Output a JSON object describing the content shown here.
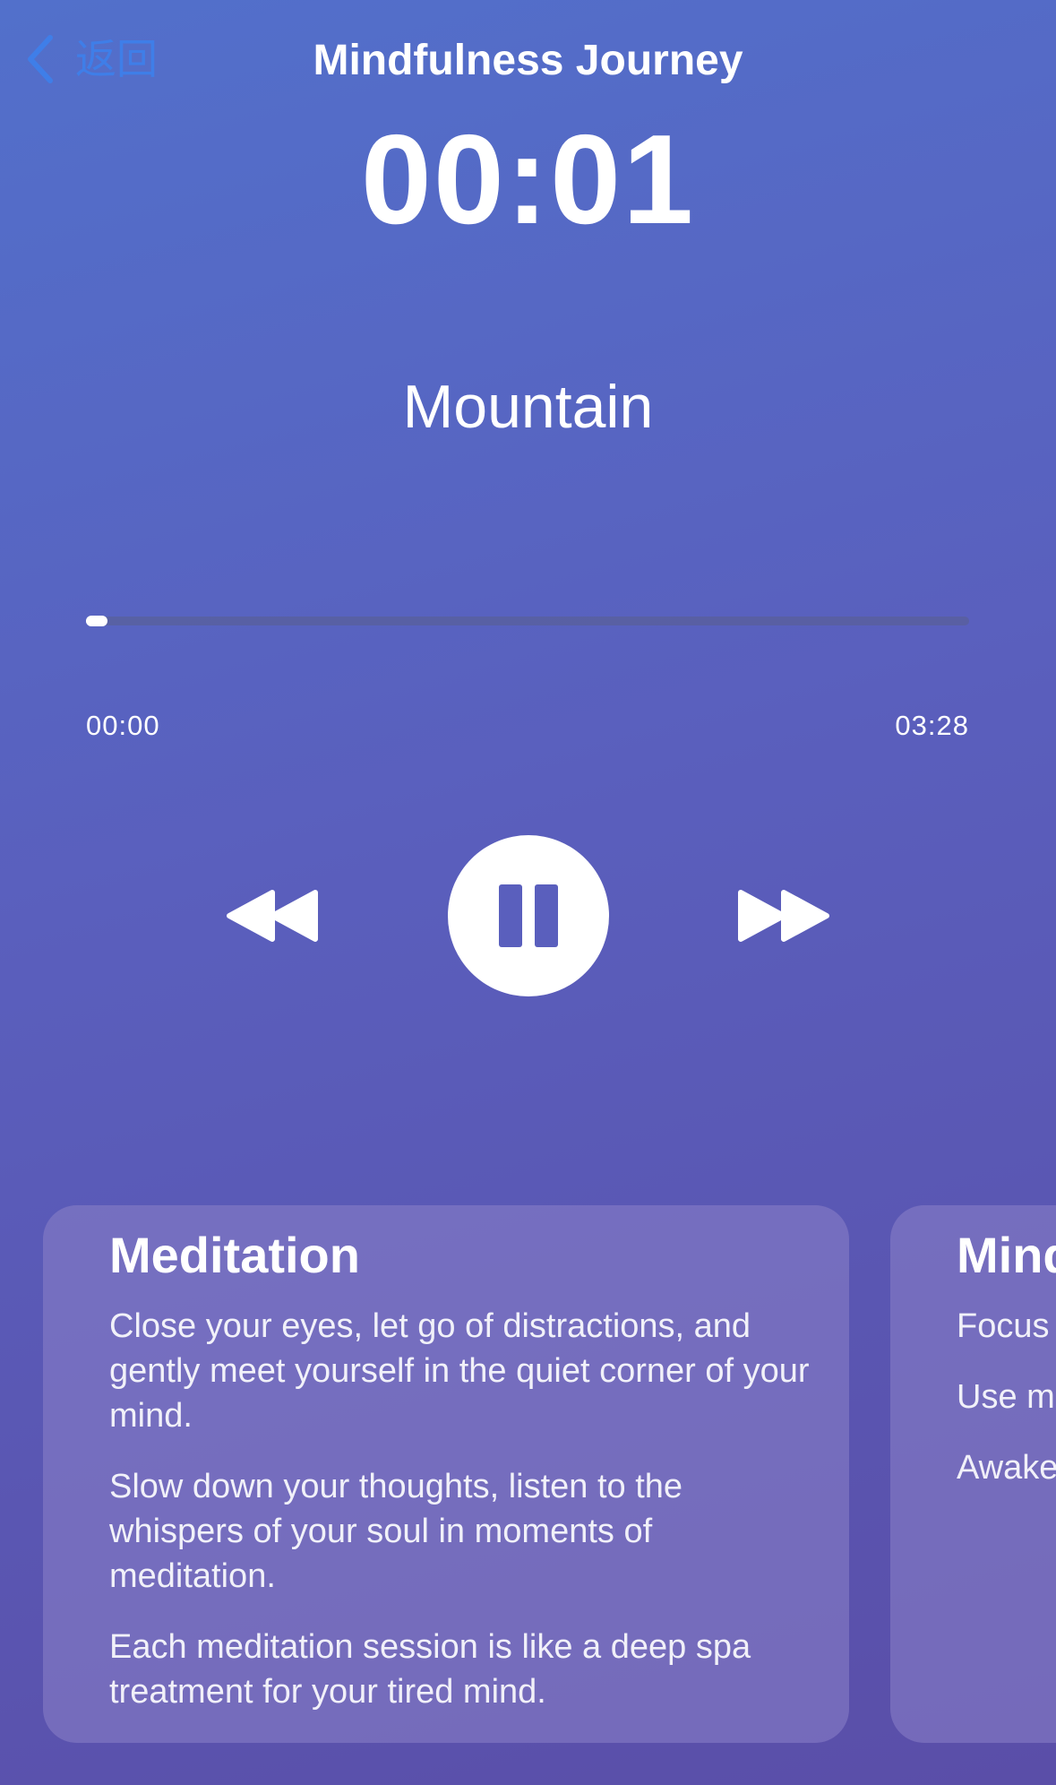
{
  "nav": {
    "back_label": "返回",
    "title": "Mindfulness Journey"
  },
  "player": {
    "timer": "00:01",
    "track_name": "Mountain",
    "progress_fraction": 0.01,
    "current_time": "00:00",
    "total_time": "03:28"
  },
  "controls": {
    "rewind_icon": "rewind-icon",
    "pause_icon": "pause-icon",
    "forward_icon": "fast-forward-icon"
  },
  "cards": [
    {
      "title": "Meditation",
      "paragraphs": [
        "Close your eyes, let go of distractions, and gently meet yourself in the quiet corner of your mind.",
        "Slow down your thoughts, listen to the whispers of your soul in moments of meditation.",
        "Each meditation session is like a deep spa treatment for your tired mind."
      ]
    },
    {
      "title": "Mind",
      "paragraphs": [
        "Focus o attentic illumina",
        "Use mi the con life.",
        "Awaken and har"
      ]
    }
  ],
  "colors": {
    "accent_blue": "#3f7ee8",
    "background_top": "#5270cb",
    "background_bottom": "#5a4ea8",
    "pause_glyph": "#5a5fbd"
  }
}
